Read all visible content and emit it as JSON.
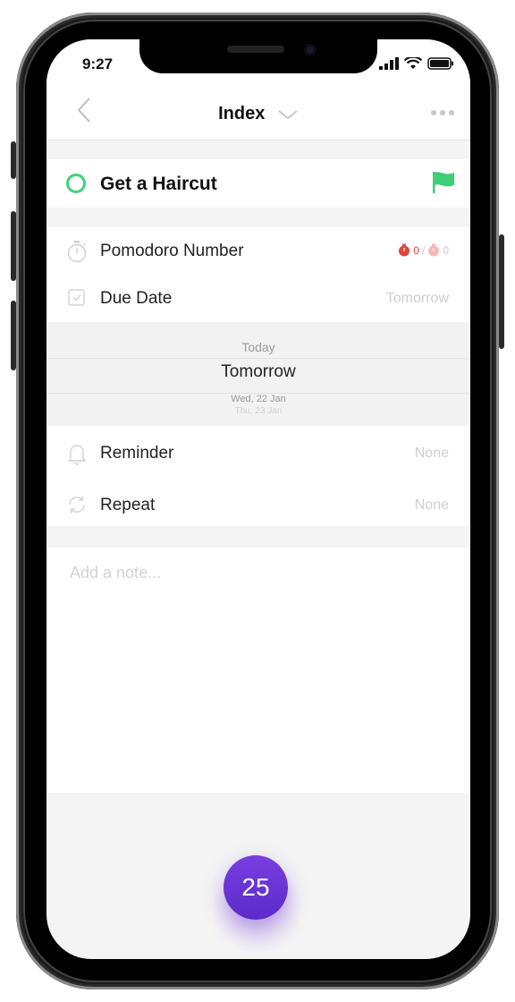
{
  "status": {
    "time": "9:27"
  },
  "nav": {
    "title": "Index"
  },
  "task": {
    "title": "Get a Haircut",
    "flag_color": "#3ecf78",
    "circle_color": "#3ed37a"
  },
  "details": {
    "pomodoro": {
      "label": "Pomodoro Number",
      "done": "0",
      "separator": "/",
      "total": "0"
    },
    "due": {
      "label": "Due Date",
      "value": "Tomorrow"
    }
  },
  "picker": {
    "prev": "Today",
    "selected": "Tomorrow",
    "next1": "Wed, 22 Jan",
    "next2": "Thu, 23 Jan"
  },
  "reminder": {
    "label": "Reminder",
    "value": "None"
  },
  "repeat": {
    "label": "Repeat",
    "value": "None"
  },
  "note": {
    "placeholder": "Add a note..."
  },
  "timer_button": {
    "label": "25",
    "color": "#6a34d6"
  },
  "icons": [
    "back-chevron-icon",
    "dropdown-chevron-icon",
    "more-dots-icon",
    "flag-icon",
    "stopwatch-icon",
    "calendar-check-icon",
    "bell-icon",
    "repeat-icon",
    "signal-icon",
    "wifi-icon",
    "battery-icon"
  ]
}
